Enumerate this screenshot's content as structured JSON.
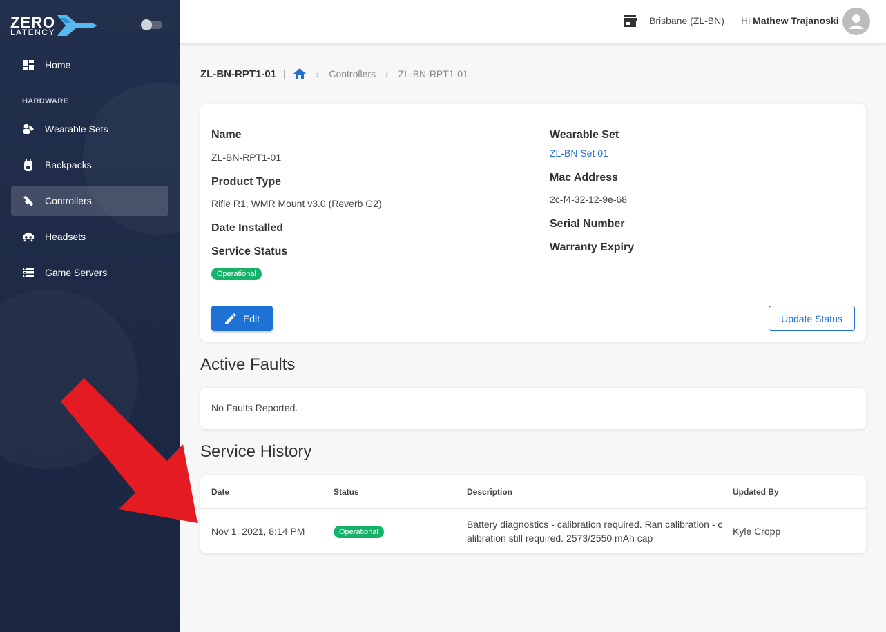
{
  "brand": {
    "line1": "ZERO",
    "line2": "LATENCY"
  },
  "sidebar": {
    "home": "Home",
    "heading": "HARDWARE",
    "items": [
      {
        "label": "Wearable Sets",
        "icon": "wearable-sets-icon"
      },
      {
        "label": "Backpacks",
        "icon": "backpack-icon"
      },
      {
        "label": "Controllers",
        "icon": "controller-icon"
      },
      {
        "label": "Headsets",
        "icon": "headset-icon"
      },
      {
        "label": "Game Servers",
        "icon": "server-icon"
      }
    ],
    "active": "Controllers"
  },
  "topbar": {
    "location": "Brisbane (ZL-BN)",
    "greeting": "Hi",
    "user": "Mathew Trajanoski"
  },
  "breadcrumb": {
    "title": "ZL-BN-RPT1-01",
    "separator": "|",
    "items": [
      "Controllers",
      "ZL-BN-RPT1-01"
    ]
  },
  "details": {
    "name_label": "Name",
    "name_value": "ZL-BN-RPT1-01",
    "product_type_label": "Product Type",
    "product_type_value": "Rifle R1, WMR Mount v3.0 (Reverb G2)",
    "date_installed_label": "Date Installed",
    "service_status_label": "Service Status",
    "service_status_value": "Operational",
    "wearable_set_label": "Wearable Set",
    "wearable_set_value": "ZL-BN Set 01",
    "mac_label": "Mac Address",
    "mac_value": "2c-f4-32-12-9e-68",
    "serial_label": "Serial Number",
    "warranty_label": "Warranty Expiry",
    "edit_button": "Edit",
    "update_status_button": "Update Status"
  },
  "faults": {
    "title": "Active Faults",
    "message": "No Faults Reported."
  },
  "history": {
    "title": "Service History",
    "columns": [
      "Date",
      "Status",
      "Description",
      "Updated By"
    ],
    "rows": [
      {
        "date": "Nov 1, 2021, 8:14 PM",
        "status": "Operational",
        "description_line1": "Battery diagnostics - calibration required. Ran calibration - c",
        "description_line2": "alibration still required. 2573/2550 mAh cap",
        "updated_by": "Kyle Cropp"
      }
    ]
  },
  "colors": {
    "sidebar_bg": "#1e2a46",
    "accent": "#1e72d6",
    "status_green": "#17b26a",
    "annotation_arrow": "#e41b23"
  }
}
